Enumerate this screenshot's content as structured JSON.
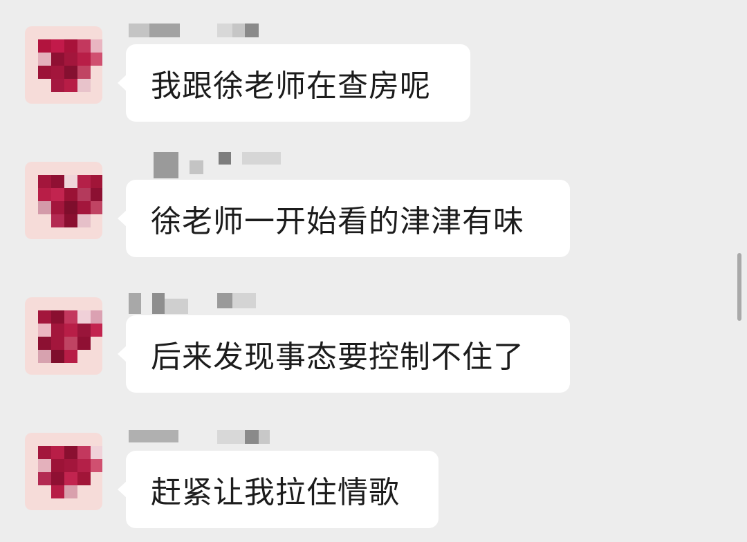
{
  "chat": {
    "messages": [
      {
        "text": "我跟徐老师在查房呢"
      },
      {
        "text": "徐老师一开始看的津津有味"
      },
      {
        "text": "后来发现事态要控制不住了"
      },
      {
        "text": "赶紧让我拉住情歌"
      }
    ]
  },
  "colors": {
    "background": "#ededed",
    "bubble": "#ffffff",
    "avatar_primary": "#a3163c",
    "avatar_light": "#f6dcd9"
  },
  "icons": {
    "avatar": "pixelated-avatar-icon",
    "scrollbar": "scrollbar-thumb"
  }
}
